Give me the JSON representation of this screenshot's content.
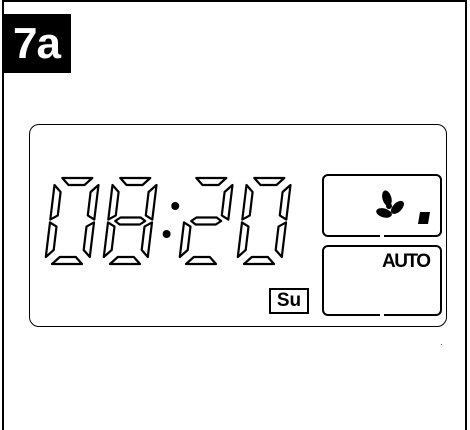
{
  "step": {
    "label": "7a"
  },
  "display": {
    "time": "08:20",
    "day": "Su",
    "mode": "AUTO",
    "fan_icon": "fan-icon",
    "fan_speed_icon": "fan-speed-bar-icon"
  },
  "colors": {
    "ink": "#000000",
    "background": "#ffffff"
  }
}
